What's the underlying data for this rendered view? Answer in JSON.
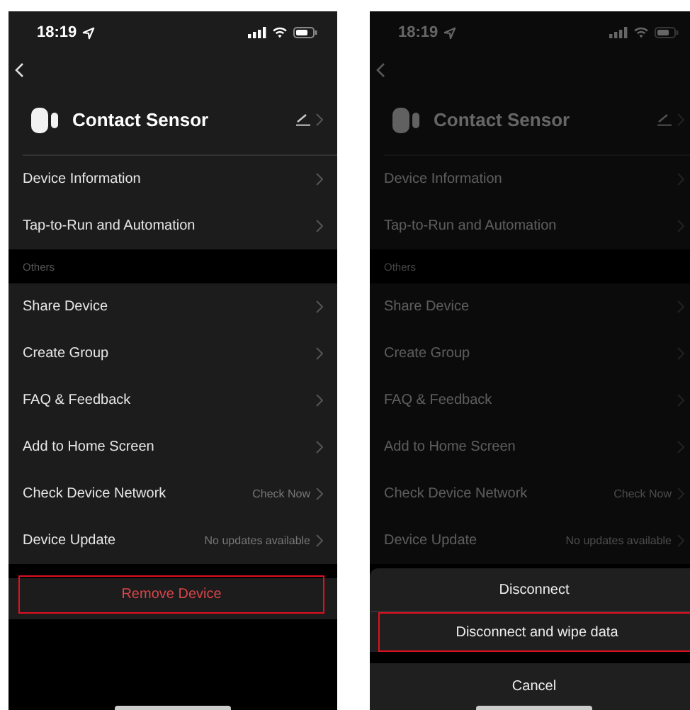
{
  "screens": [
    {
      "status_time": "18:19",
      "title": "Contact Sensor",
      "dimmed": false,
      "groups": [
        {
          "rows": [
            {
              "label": "Device Information"
            },
            {
              "label": "Tap-to-Run and Automation"
            }
          ]
        },
        {
          "heading": "Others",
          "rows": [
            {
              "label": "Share Device"
            },
            {
              "label": "Create Group"
            },
            {
              "label": "FAQ & Feedback"
            },
            {
              "label": "Add to Home Screen"
            },
            {
              "label": "Check Device Network",
              "value": "Check Now"
            },
            {
              "label": "Device Update",
              "value": "No updates available"
            }
          ]
        }
      ],
      "remove_button": {
        "label": "Remove Device",
        "highlighted": true
      }
    },
    {
      "status_time": "18:19",
      "title": "Contact Sensor",
      "dimmed": true,
      "groups": [
        {
          "rows": [
            {
              "label": "Device Information"
            },
            {
              "label": "Tap-to-Run and Automation"
            }
          ]
        },
        {
          "heading": "Others",
          "rows": [
            {
              "label": "Share Device"
            },
            {
              "label": "Create Group"
            },
            {
              "label": "FAQ & Feedback"
            },
            {
              "label": "Add to Home Screen"
            },
            {
              "label": "Check Device Network",
              "value": "Check Now"
            },
            {
              "label": "Device Update",
              "value": "No updates available"
            }
          ]
        }
      ],
      "action_sheet": {
        "options": [
          {
            "label": "Disconnect",
            "highlighted": false
          },
          {
            "label": "Disconnect and wipe data",
            "highlighted": true
          }
        ],
        "cancel": "Cancel"
      }
    }
  ]
}
